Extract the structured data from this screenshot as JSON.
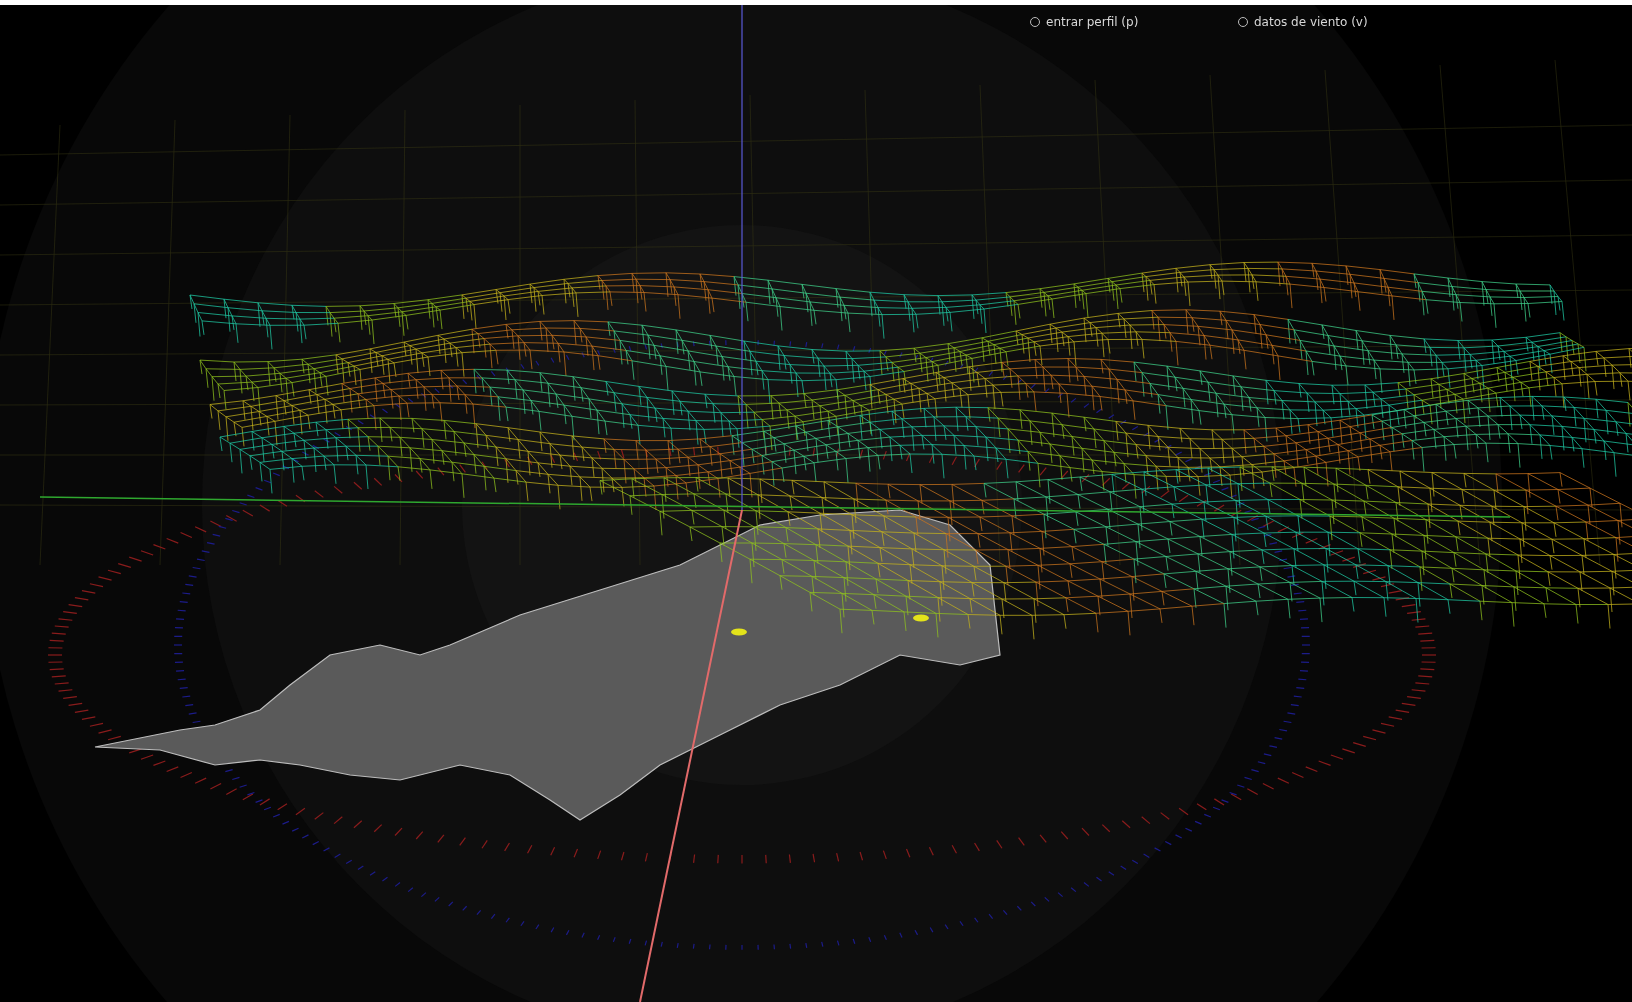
{
  "options": [
    {
      "label": "entrar perfil (p)",
      "selected": false
    },
    {
      "label": "datos de viento (v)",
      "selected": false
    }
  ]
}
